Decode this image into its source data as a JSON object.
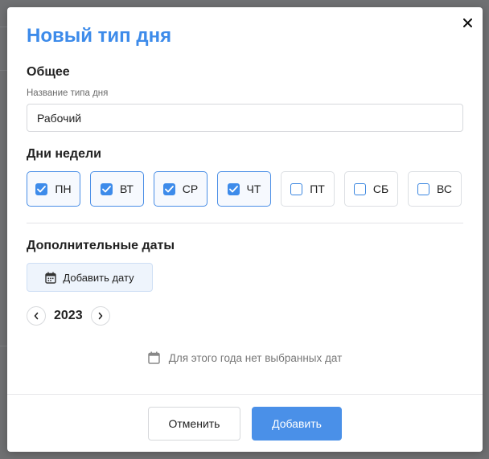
{
  "dialog": {
    "title": "Новый тип дня",
    "close_icon": "close-icon"
  },
  "general": {
    "heading": "Общее",
    "name_label": "Название типа дня",
    "name_value": "Рабочий"
  },
  "weekdays": {
    "heading": "Дни недели",
    "items": [
      {
        "label": "ПН",
        "checked": true
      },
      {
        "label": "ВТ",
        "checked": true
      },
      {
        "label": "СР",
        "checked": true
      },
      {
        "label": "ЧТ",
        "checked": true
      },
      {
        "label": "ПТ",
        "checked": false
      },
      {
        "label": "СБ",
        "checked": false
      },
      {
        "label": "ВС",
        "checked": false
      }
    ]
  },
  "extra_dates": {
    "heading": "Дополнительные даты",
    "add_button_label": "Добавить дату",
    "add_button_icon": "calendar-icon",
    "year": "2023",
    "prev_icon": "chevron-left-icon",
    "next_icon": "chevron-right-icon",
    "empty_text": "Для этого года нет выбранных дат",
    "empty_icon": "calendar-icon"
  },
  "footer": {
    "cancel_label": "Отменить",
    "submit_label": "Добавить"
  },
  "colors": {
    "accent": "#3d8bea",
    "primary_button": "#4a90e8",
    "overlay": "#6f7072"
  }
}
